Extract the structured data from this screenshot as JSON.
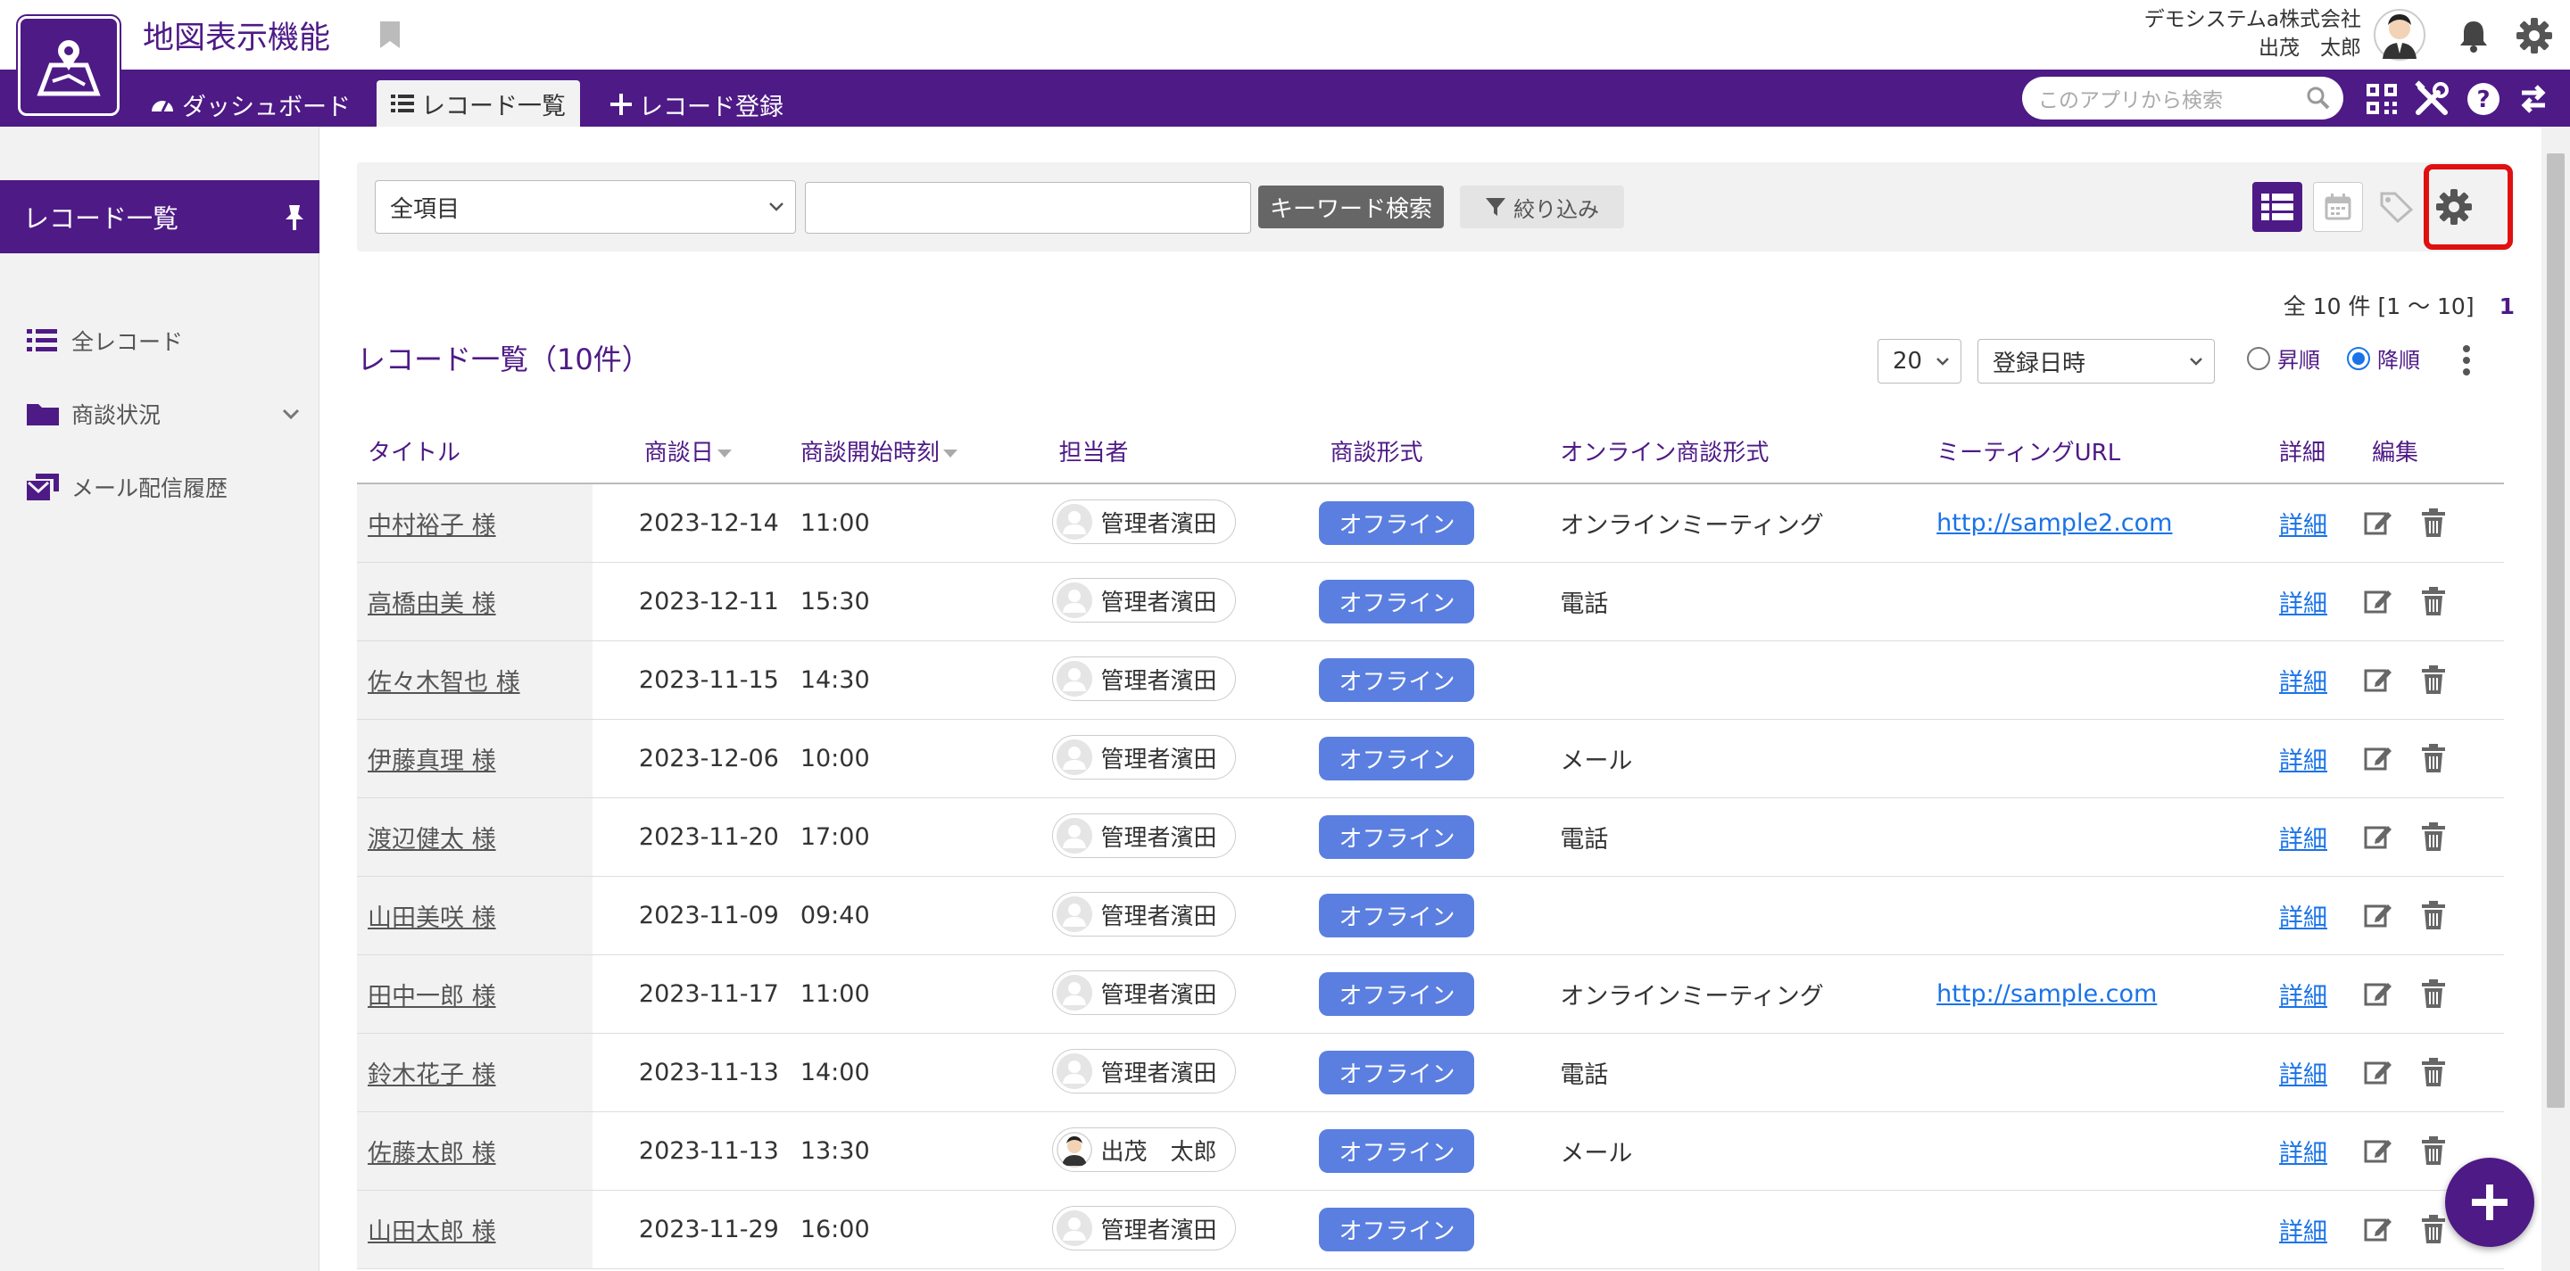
{
  "header": {
    "app_title": "地図表示機能",
    "company": "デモシステムa株式会社",
    "user_name": "出茂　太郎"
  },
  "nav": {
    "dashboard": "ダッシュボード",
    "record_list": "レコード一覧",
    "record_add": "レコード登録",
    "search_placeholder": "このアプリから検索"
  },
  "sidebar": {
    "heading": "レコード一覧",
    "items": [
      {
        "label": "全レコード",
        "icon": "list-icon"
      },
      {
        "label": "商談状況",
        "icon": "folder-icon"
      },
      {
        "label": "メール配信履歴",
        "icon": "mail-history-icon"
      }
    ]
  },
  "toolbar": {
    "field_select": "全項目",
    "keyword_value": "",
    "keyword_button": "キーワード検索",
    "filter_button": "絞り込み"
  },
  "list": {
    "title": "レコード一覧（10件）",
    "count_text": "全 10 件 [1 〜 10]",
    "page": "1",
    "per_page": "20",
    "sort_field": "登録日時",
    "asc_label": "昇順",
    "desc_label": "降順",
    "sort_order": "desc"
  },
  "table": {
    "headers": [
      "タイトル",
      "商談日",
      "商談開始時刻",
      "担当者",
      "商談形式",
      "オンライン商談形式",
      "ミーティングURL",
      "詳細",
      "編集"
    ],
    "rows": [
      {
        "title": "中村裕子 様",
        "date": "2023-12-14",
        "time": "11:00",
        "owner": "管理者濱田",
        "mode": "オフライン",
        "online_type": "オンラインミーティング",
        "url": "http://sample2.com",
        "detail": "詳細"
      },
      {
        "title": "高橋由美 様",
        "date": "2023-12-11",
        "time": "15:30",
        "owner": "管理者濱田",
        "mode": "オフライン",
        "online_type": "電話",
        "url": "",
        "detail": "詳細"
      },
      {
        "title": "佐々木智也 様",
        "date": "2023-11-15",
        "time": "14:30",
        "owner": "管理者濱田",
        "mode": "オフライン",
        "online_type": "",
        "url": "",
        "detail": "詳細"
      },
      {
        "title": "伊藤真理 様",
        "date": "2023-12-06",
        "time": "10:00",
        "owner": "管理者濱田",
        "mode": "オフライン",
        "online_type": "メール",
        "url": "",
        "detail": "詳細"
      },
      {
        "title": "渡辺健太 様",
        "date": "2023-11-20",
        "time": "17:00",
        "owner": "管理者濱田",
        "mode": "オフライン",
        "online_type": "電話",
        "url": "",
        "detail": "詳細"
      },
      {
        "title": "山田美咲 様",
        "date": "2023-11-09",
        "time": "09:40",
        "owner": "管理者濱田",
        "mode": "オフライン",
        "online_type": "",
        "url": "",
        "detail": "詳細"
      },
      {
        "title": "田中一郎 様",
        "date": "2023-11-17",
        "time": "11:00",
        "owner": "管理者濱田",
        "mode": "オフライン",
        "online_type": "オンラインミーティング",
        "url": "http://sample.com",
        "detail": "詳細"
      },
      {
        "title": "鈴木花子 様",
        "date": "2023-11-13",
        "time": "14:00",
        "owner": "管理者濱田",
        "mode": "オフライン",
        "online_type": "電話",
        "url": "",
        "detail": "詳細"
      },
      {
        "title": "佐藤太郎 様",
        "date": "2023-11-13",
        "time": "13:30",
        "owner": "出茂　太郎",
        "mode": "オフライン",
        "online_type": "メール",
        "url": "",
        "detail": "詳細"
      },
      {
        "title": "山田太郎 様",
        "date": "2023-11-29",
        "time": "16:00",
        "owner": "管理者濱田",
        "mode": "オフライン",
        "online_type": "",
        "url": "",
        "detail": "詳細"
      }
    ]
  },
  "colors": {
    "brand": "#4e1a86",
    "pill": "#5b7fe0",
    "link": "#1a73e8",
    "highlight": "#e01010"
  }
}
